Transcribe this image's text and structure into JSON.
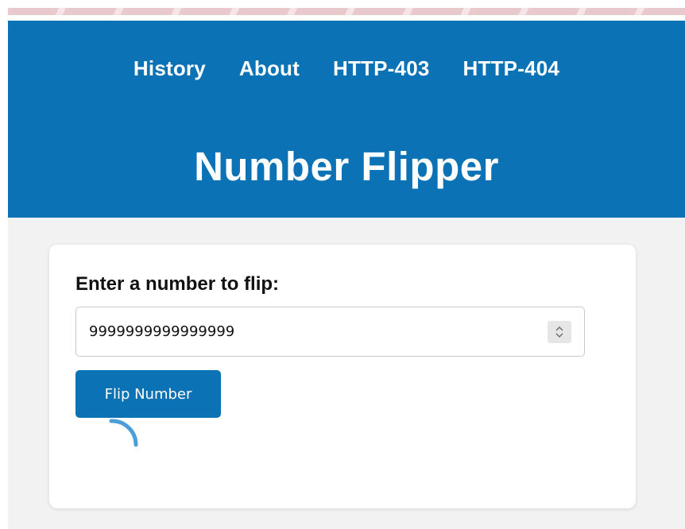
{
  "nav": {
    "items": [
      {
        "label": "History"
      },
      {
        "label": "About"
      },
      {
        "label": "HTTP-403"
      },
      {
        "label": "HTTP-404"
      }
    ]
  },
  "header": {
    "title": "Number Flipper"
  },
  "form": {
    "label": "Enter a number to flip:",
    "input_value": "9999999999999999",
    "button_label": "Flip Number"
  },
  "icons": {
    "spinner": "stepper-arrows-icon",
    "loading": "loading-spinner-icon"
  },
  "colors": {
    "brand": "#0a72b5",
    "background": "#f2f2f2",
    "card": "#ffffff",
    "spinner": "#4a9fd8"
  }
}
